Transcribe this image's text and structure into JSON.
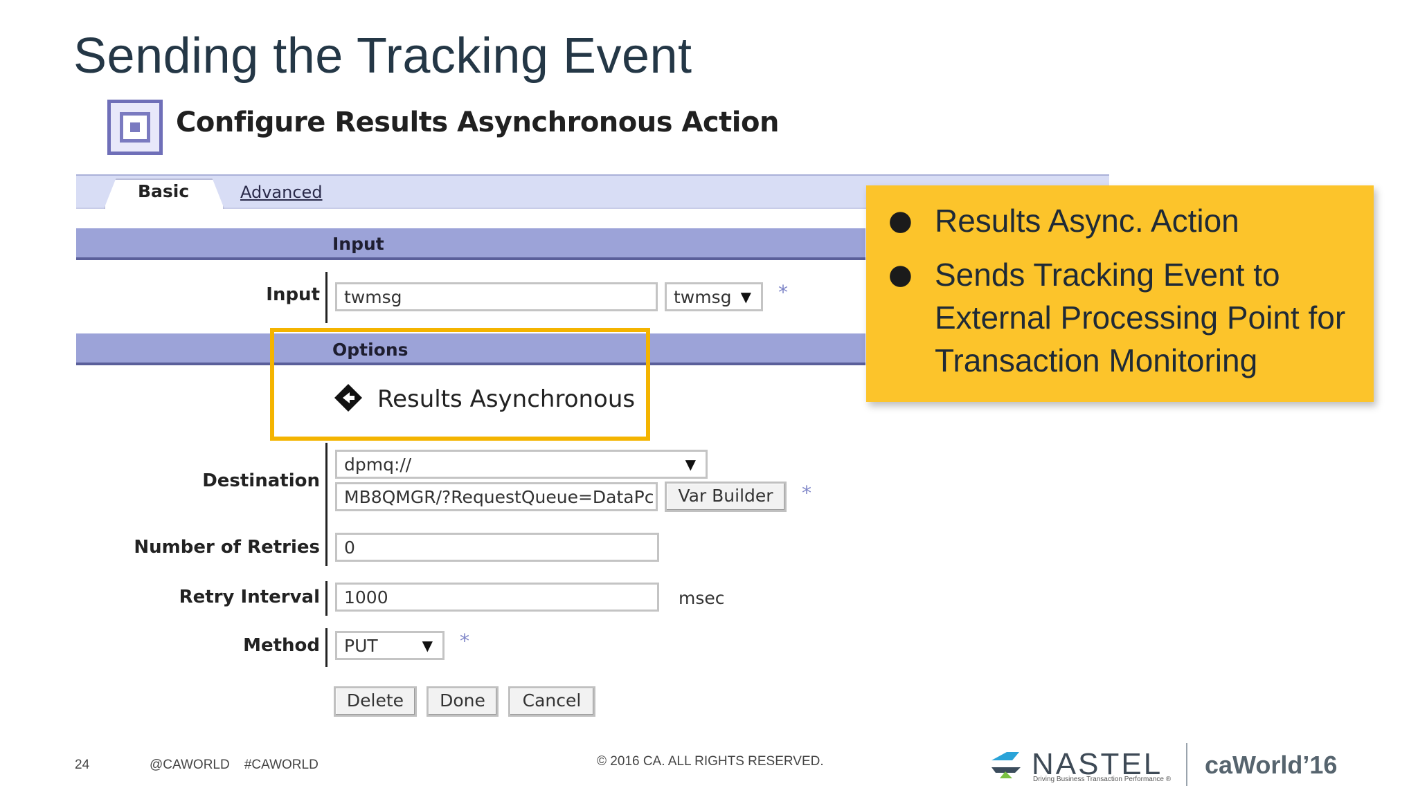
{
  "slide": {
    "title": "Sending the Tracking Event"
  },
  "dialog": {
    "title": "Configure Results Asynchronous Action",
    "tabs": [
      {
        "label": "Basic",
        "active": true
      },
      {
        "label": "Advanced",
        "active": false
      }
    ],
    "sections": {
      "input": "Input",
      "options": "Options"
    },
    "input": {
      "label": "Input",
      "value": "twmsg",
      "selected_option": "twmsg"
    },
    "options": {
      "action_label": "Results Asynchronous"
    },
    "destination": {
      "label": "Destination",
      "protocol_selected": "dpmq://",
      "value": "MB8QMGR/?RequestQueue=DataPc",
      "var_builder_label": "Var Builder"
    },
    "retries": {
      "label": "Number of Retries",
      "value": "0"
    },
    "retry_interval": {
      "label": "Retry Interval",
      "value": "1000",
      "unit": "msec"
    },
    "method": {
      "label": "Method",
      "selected": "PUT"
    },
    "buttons": {
      "delete": "Delete",
      "done": "Done",
      "cancel": "Cancel"
    },
    "required_marker": "*"
  },
  "callout": {
    "bullets": [
      "Results Async. Action",
      "Sends Tracking Event to External Processing Point for Transaction Monitoring"
    ]
  },
  "footer": {
    "page_number": "24",
    "social": "@CAWORLD    #CAWORLD",
    "copyright": "© 2016 CA. ALL RIGHTS RESERVED.",
    "nastel_name": "NASTEL",
    "nastel_tagline": "Driving Business Transaction Performance ®",
    "ca_world": "caWorld’16"
  },
  "colors": {
    "callout": "#fcc42b",
    "highlight_border": "#f4b400",
    "section_bar": "#9ca3d8",
    "tab_bar": "#d8ddf5"
  },
  "icons": {
    "dialog": "action-box-icon",
    "options_action": "diamond-arrow-icon",
    "nastel": "nastel-logo-icon"
  }
}
